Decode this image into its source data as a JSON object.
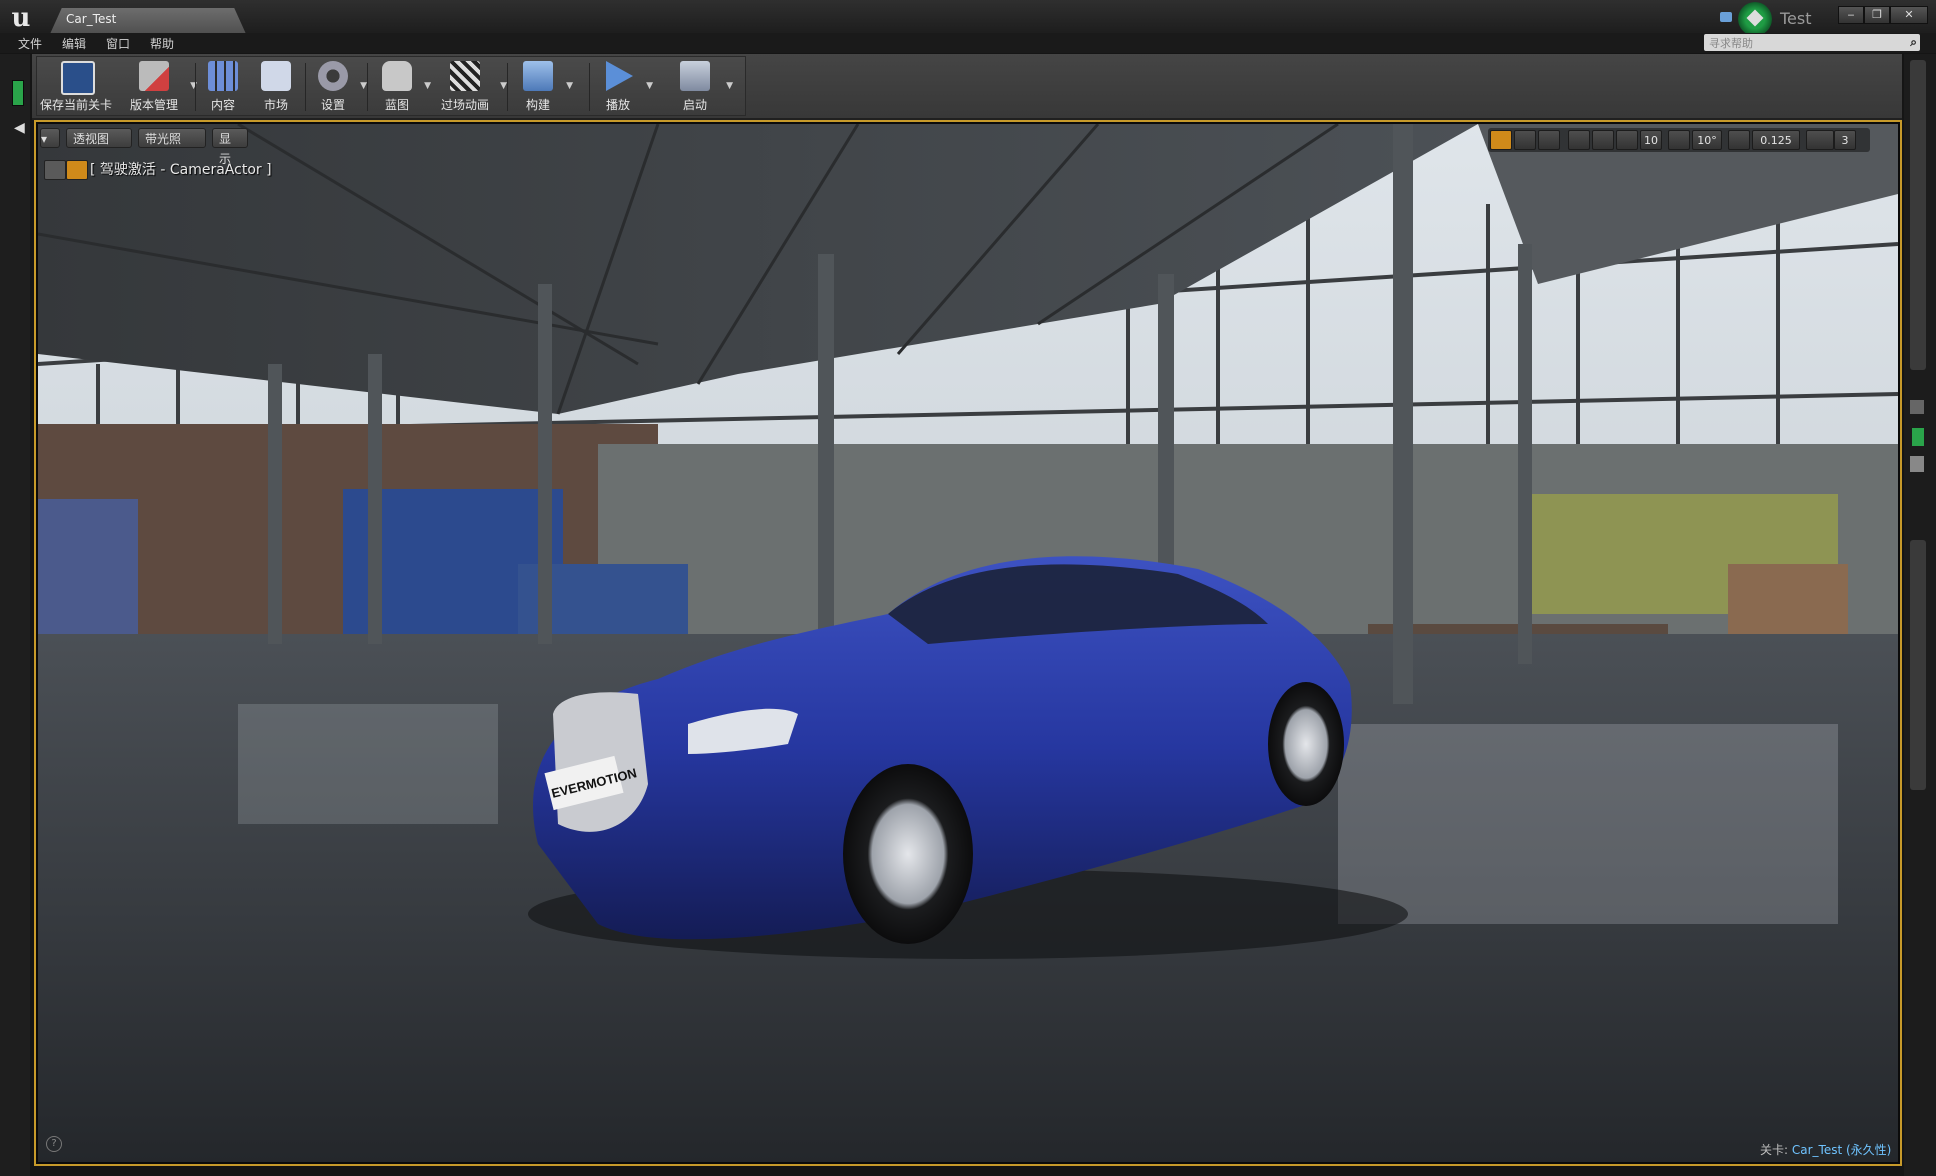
{
  "window": {
    "tab_title": "Car_Test",
    "project_name": "Test",
    "buttons": [
      "‒",
      "❐",
      "✕"
    ]
  },
  "menu": [
    "文件",
    "编辑",
    "窗口",
    "帮助"
  ],
  "search": {
    "placeholder": "寻求帮助",
    "icon": "search-icon"
  },
  "toolbar": [
    {
      "label": "保存当前关卡",
      "icon": "save-icon",
      "color": "#e8e8e8",
      "dropdown": false
    },
    {
      "label": "版本管理",
      "icon": "source-control-icon",
      "color": "#d04040",
      "dropdown": true
    },
    {
      "label": "内容",
      "icon": "content-icon",
      "color": "#6d8ed8",
      "dropdown": false
    },
    {
      "label": "市场",
      "icon": "marketplace-icon",
      "color": "#9ab0d0",
      "dropdown": false
    },
    {
      "label": "设置",
      "icon": "settings-icon",
      "color": "#9a9aa8",
      "dropdown": true
    },
    {
      "label": "蓝图",
      "icon": "blueprint-icon",
      "color": "#c8c8c8",
      "dropdown": true
    },
    {
      "label": "过场动画",
      "icon": "cinematics-icon",
      "color": "#bcbcbc",
      "dropdown": true
    },
    {
      "label": "构建",
      "icon": "build-icon",
      "color": "#7fa8d8",
      "dropdown": true
    },
    {
      "label": "播放",
      "icon": "play-icon",
      "color": "#5b8fd8",
      "dropdown": true
    },
    {
      "label": "启动",
      "icon": "launch-icon",
      "color": "#a0a8b8",
      "dropdown": true
    }
  ],
  "viewport": {
    "buttons": [
      {
        "label": "▾"
      },
      {
        "label": "透视图"
      },
      {
        "label": "带光照"
      },
      {
        "label": "显示"
      }
    ],
    "pilot_text": "[ 驾驶激活 - CameraActor ]",
    "snap": {
      "grid": "10",
      "rotation": "10°",
      "scale": "0.125",
      "camera_speed": "3"
    },
    "level_label": "关卡:",
    "level_name": "Car_Test (永久性)",
    "car_plate": "EVERMOTION",
    "help": "?"
  }
}
